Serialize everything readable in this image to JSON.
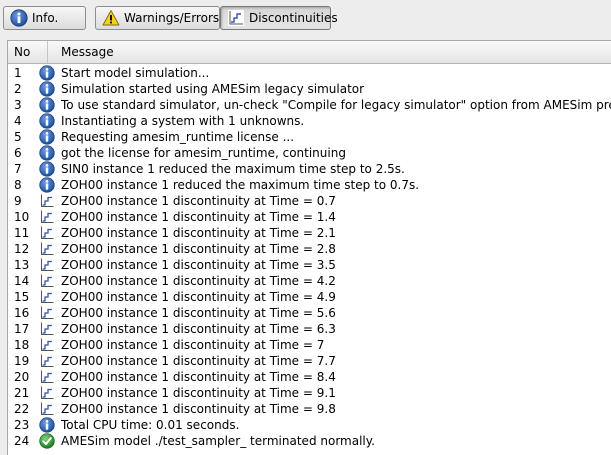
{
  "toolbar": {
    "info_label": "Info.",
    "warnings_label": "Warnings/Errors",
    "discontinuities_label": "Discontinuities"
  },
  "table": {
    "col_no": "No",
    "col_message": "Message",
    "rows": [
      {
        "no": "1",
        "type": "info",
        "message": "Start model simulation..."
      },
      {
        "no": "2",
        "type": "info",
        "message": "Simulation started using AMESim legacy simulator"
      },
      {
        "no": "3",
        "type": "info",
        "message": "To use standard simulator, un-check \"Compile for legacy simulator\" option from AMESim preferences."
      },
      {
        "no": "4",
        "type": "info",
        "message": "Instantiating a system with 1 unknowns."
      },
      {
        "no": "5",
        "type": "info",
        "message": "Requesting amesim_runtime license ..."
      },
      {
        "no": "6",
        "type": "info",
        "message": "got the license for amesim_runtime, continuing"
      },
      {
        "no": "7",
        "type": "info",
        "message": "SIN0 instance 1 reduced the maximum time step to 2.5s."
      },
      {
        "no": "8",
        "type": "info",
        "message": "ZOH00 instance 1 reduced the maximum time step to 0.7s."
      },
      {
        "no": "9",
        "type": "discontinuity",
        "message": "ZOH00 instance 1 discontinuity at Time = 0.7"
      },
      {
        "no": "10",
        "type": "discontinuity",
        "message": "ZOH00 instance 1 discontinuity at Time = 1.4"
      },
      {
        "no": "11",
        "type": "discontinuity",
        "message": "ZOH00 instance 1 discontinuity at Time = 2.1"
      },
      {
        "no": "12",
        "type": "discontinuity",
        "message": "ZOH00 instance 1 discontinuity at Time = 2.8"
      },
      {
        "no": "13",
        "type": "discontinuity",
        "message": "ZOH00 instance 1 discontinuity at Time = 3.5"
      },
      {
        "no": "14",
        "type": "discontinuity",
        "message": "ZOH00 instance 1 discontinuity at Time = 4.2"
      },
      {
        "no": "15",
        "type": "discontinuity",
        "message": "ZOH00 instance 1 discontinuity at Time = 4.9"
      },
      {
        "no": "16",
        "type": "discontinuity",
        "message": "ZOH00 instance 1 discontinuity at Time = 5.6"
      },
      {
        "no": "17",
        "type": "discontinuity",
        "message": "ZOH00 instance 1 discontinuity at Time = 6.3"
      },
      {
        "no": "18",
        "type": "discontinuity",
        "message": "ZOH00 instance 1 discontinuity at Time = 7"
      },
      {
        "no": "19",
        "type": "discontinuity",
        "message": "ZOH00 instance 1 discontinuity at Time = 7.7"
      },
      {
        "no": "20",
        "type": "discontinuity",
        "message": "ZOH00 instance 1 discontinuity at Time = 8.4"
      },
      {
        "no": "21",
        "type": "discontinuity",
        "message": "ZOH00 instance 1 discontinuity at Time = 9.1"
      },
      {
        "no": "22",
        "type": "discontinuity",
        "message": "ZOH00 instance 1 discontinuity at Time = 9.8"
      },
      {
        "no": "23",
        "type": "info",
        "message": "Total CPU time: 0.01 seconds."
      },
      {
        "no": "24",
        "type": "success",
        "message": "AMESim model ./test_sampler_ terminated normally."
      }
    ]
  },
  "icons": {
    "info": "info-icon",
    "warning": "warning-icon",
    "discontinuity": "discontinuity-icon",
    "success": "success-check-icon"
  },
  "colors": {
    "info_blue": "#2a5fb4",
    "success_green": "#2e9a2e",
    "warning_yellow": "#f2d21a",
    "discontinuity_blue": "#3355aa"
  }
}
